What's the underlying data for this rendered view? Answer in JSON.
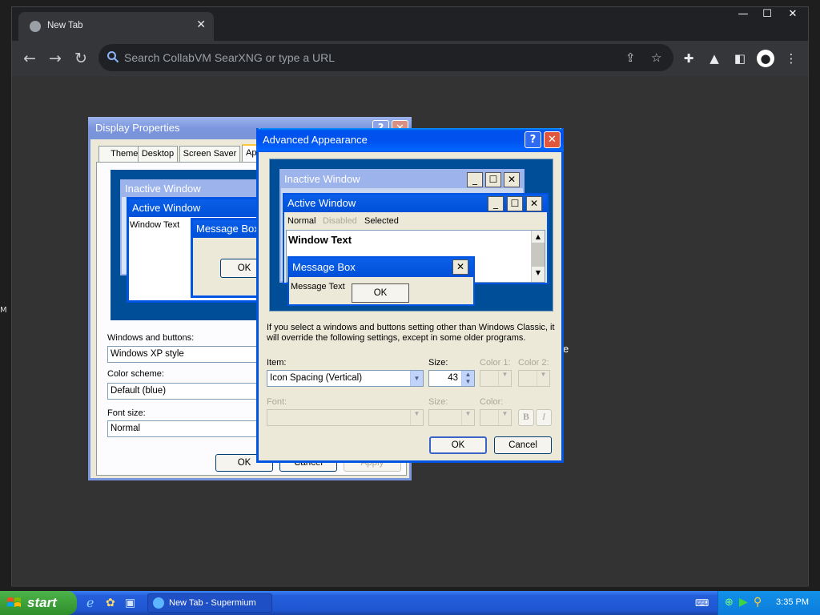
{
  "browser": {
    "tab_title": "New Tab",
    "omnibox_placeholder": "Search CollabVM SearXNG or type a URL"
  },
  "display_properties": {
    "title": "Display Properties",
    "tabs": [
      "Themes",
      "Desktop",
      "Screen Saver",
      "App"
    ],
    "preview": {
      "inactive_title": "Inactive Window",
      "active_title": "Active Window",
      "window_text": "Window Text",
      "message_title": "Message Box",
      "ok_label": "OK"
    },
    "windows_buttons_label": "Windows and buttons:",
    "windows_buttons_value": "Windows XP style",
    "color_scheme_label": "Color scheme:",
    "color_scheme_value": "Default (blue)",
    "font_size_label": "Font size:",
    "font_size_value": "Normal",
    "ok_label": "OK",
    "cancel_label": "Cancel",
    "apply_label": "Apply",
    "edge_char": "e"
  },
  "advanced_appearance": {
    "title": "Advanced Appearance",
    "help_label": "?",
    "preview": {
      "inactive_title": "Inactive Window",
      "active_title": "Active Window",
      "menu_normal": "Normal",
      "menu_disabled": "Disabled",
      "menu_selected": "Selected",
      "window_text": "Window Text",
      "message_title": "Message Box",
      "message_text": "Message Text",
      "ok_label": "OK"
    },
    "info_text": "If you select a windows and buttons setting other than Windows Classic, it will override the following settings, except in some older programs.",
    "item_label": "Item:",
    "item_value": "Icon Spacing (Vertical)",
    "size_label": "Size:",
    "size_value": "43",
    "color1_label": "Color 1:",
    "color2_label": "Color 2:",
    "font_label": "Font:",
    "font_size_label": "Size:",
    "font_color_label": "Color:",
    "bold_label": "B",
    "italic_label": "I",
    "ok_label": "OK",
    "cancel_label": "Cancel"
  },
  "taskbar": {
    "start_label": "start",
    "task_label": "New Tab - Supermium",
    "clock": "3:35 PM"
  },
  "colors": {
    "xp_blue": "#0054e3",
    "xp_inactive": "#7a96df",
    "start_green": "#3c9a38",
    "chrome_dark": "#202124"
  }
}
